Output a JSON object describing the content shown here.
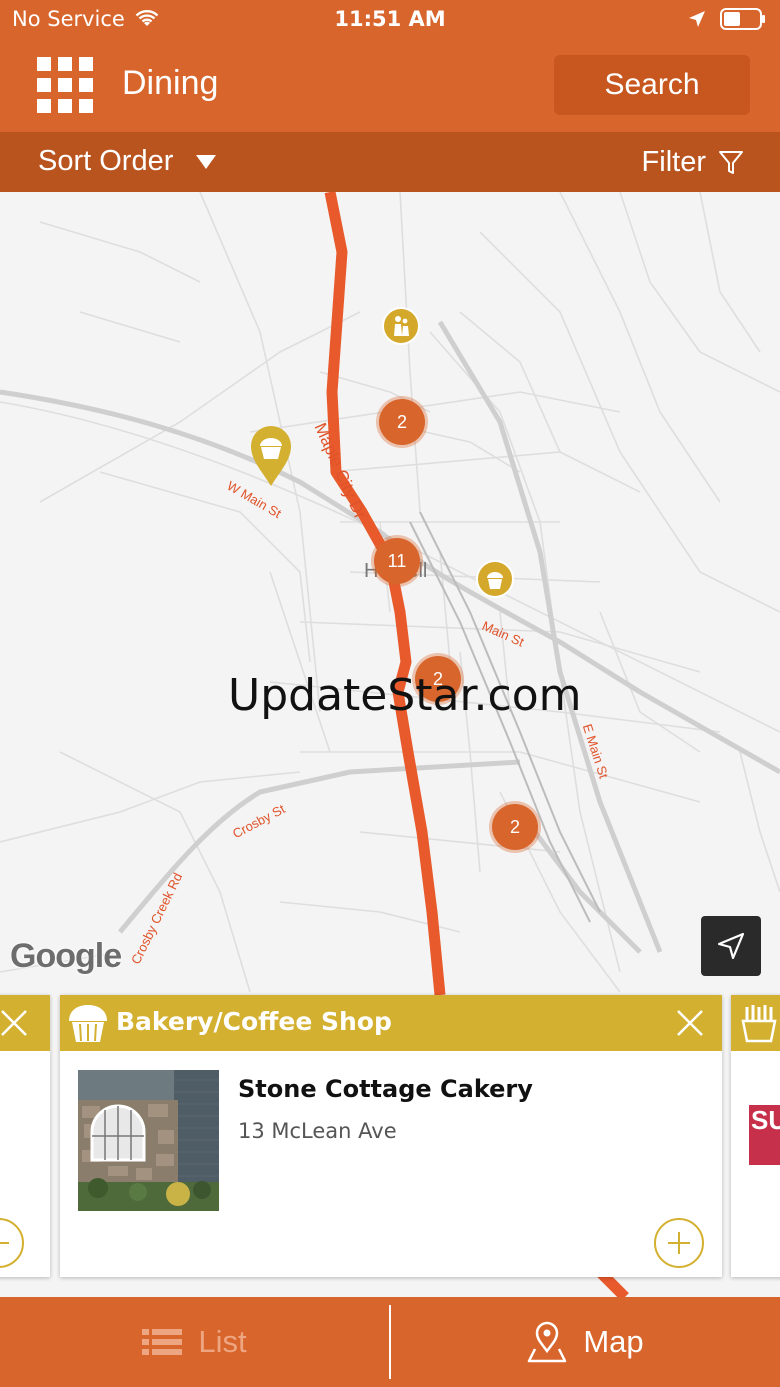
{
  "status_bar": {
    "carrier": "No Service",
    "time": "11:51 AM"
  },
  "header": {
    "title": "Dining",
    "search_label": "Search",
    "menu_icon": "grid-menu-icon"
  },
  "sort_bar": {
    "sort_label": "Sort Order",
    "filter_label": "Filter"
  },
  "map": {
    "road_labels": {
      "maple_city_dr": "Maple City Dr",
      "w_main_st": "W Main St",
      "main_st": "Main St",
      "e_main_st": "E Main St",
      "crosby_st": "Crosby St",
      "crosby_creek_rd": "Crosby Creek Rd"
    },
    "town_label": "Hornell",
    "clusters": [
      "2",
      "11",
      "2",
      "2"
    ],
    "watermark": "UpdateStar.com",
    "attribution": "Google",
    "colors": {
      "accent": "#d8652b",
      "route": "#e85a2c",
      "poi": "#d4a82a"
    }
  },
  "cards": {
    "main": {
      "category": "Bakery/Coffee Shop",
      "name": "Stone Cottage Cakery",
      "address": "13 McLean Ave"
    },
    "right_peek_text": "SU"
  },
  "bottom_nav": {
    "list_label": "List",
    "map_label": "Map"
  }
}
